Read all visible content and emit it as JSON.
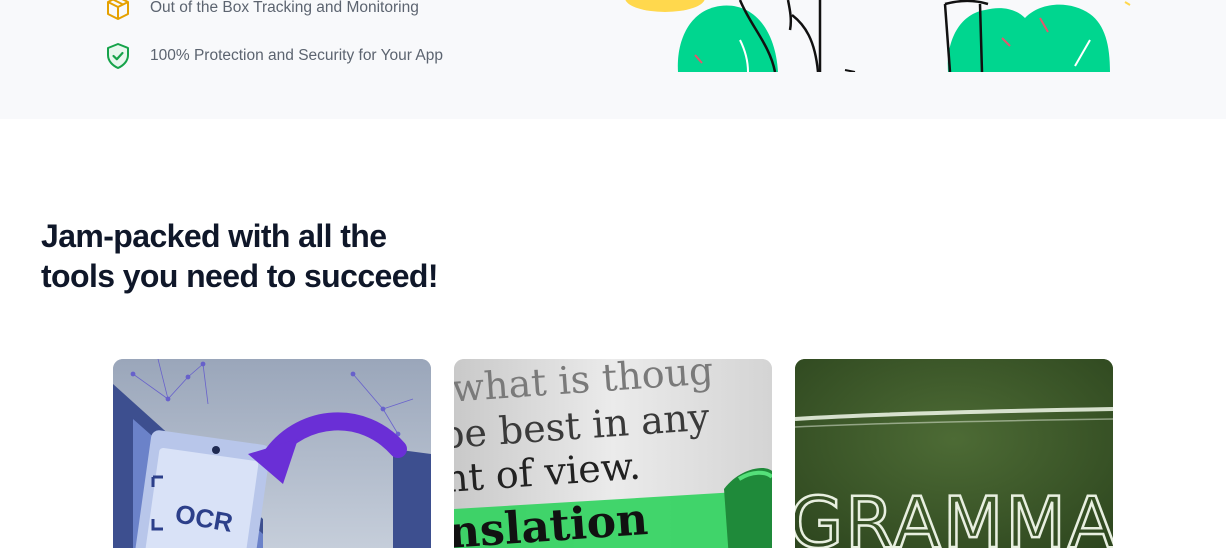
{
  "features": [
    {
      "icon": "box-icon",
      "label": "Out of the Box Tracking and Monitoring"
    },
    {
      "icon": "shield-check-icon",
      "label": "100% Protection and Security for Your App"
    }
  ],
  "section": {
    "heading_line1": "Jam-packed with all the",
    "heading_line2": "tools you need to succeed!"
  },
  "cards": [
    {
      "name": "ocr",
      "image_text": "OCR"
    },
    {
      "name": "translation",
      "image_text_lines": [
        "what is thoug",
        "be best in any",
        "nt of view.",
        "nslation"
      ]
    },
    {
      "name": "grammar",
      "image_text": "GRAMMAR"
    }
  ],
  "colors": {
    "heading": "#0f1729",
    "feature_text": "#5c6470",
    "box_icon": "#e5a100",
    "shield_icon": "#16a34a",
    "illustration_green": "#00d68f"
  }
}
